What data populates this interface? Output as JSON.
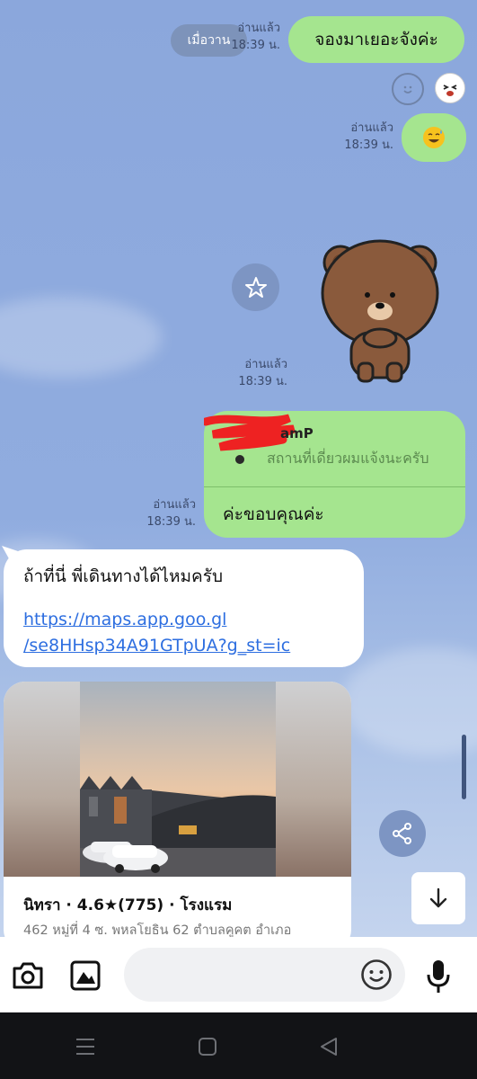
{
  "chat": {
    "date_pill": "เมื่อวาน",
    "messages": [
      {
        "text": "จองมาเยอะจังค่ะ",
        "read": "อ่านแล้ว",
        "time": "18:39 น."
      },
      {
        "read": "อ่านแล้ว",
        "time": "18:39 น."
      },
      {
        "read": "อ่านแล้ว",
        "time": "18:39 น."
      },
      {
        "quote_name_tail": "amP",
        "quote_text": "สถานที่เดี่ยวผมแจ้งนะครับ",
        "text": "ค่ะขอบคุณค่ะ",
        "read": "อ่านแล้ว",
        "time": "18:39 น."
      }
    ],
    "incoming": {
      "text": "ถ้าที่นี่ พี่เดินทางได้ไหมครับ",
      "link_line1": "https://maps.app.goo.gl",
      "link_line2": "/se8HHsp34A91GTpUA?g_st=ic"
    },
    "place_card": {
      "title": "นิทรา · 4.6★(775) · โรงแรม",
      "address": "462 หมู่ที่ 4 ซ. พหลโยธิน 62 ตำบลคูคต อำเภอ"
    }
  },
  "icons": [
    "smile-icon",
    "sticker-reaction-icon",
    "star-icon",
    "share-icon",
    "arrow-down-icon",
    "camera-icon",
    "image-icon",
    "emoji-icon",
    "mic-icon",
    "menu-icon",
    "home-icon",
    "back-icon"
  ],
  "colors": {
    "outgoing": "#a5e58f",
    "incoming": "#ffffff",
    "link": "#2d6ee0",
    "background": "#8eaadc"
  }
}
